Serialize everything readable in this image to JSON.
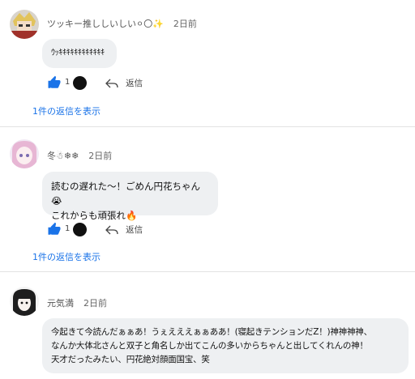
{
  "comments": [
    {
      "author": "ツッキー推ししいしい⚪︎〇✨",
      "time": "2日前",
      "text_lines": [
        "ｳｯｷｷｷｷｷｷｷｷｷｷｷｷ"
      ],
      "like_count": "1",
      "reply_label": "返信",
      "show_replies": "1件の返信を表示"
    },
    {
      "author": "冬☃❄❄",
      "time": "2日前",
      "text_lines": [
        "読むの遅れた〜！ごめん円花ちゃん😭",
        "これからも頑張れ🔥"
      ],
      "like_count": "1",
      "reply_label": "返信",
      "show_replies": "1件の返信を表示"
    },
    {
      "author": "元気満",
      "time": "2日前",
      "text_lines": [
        "今起きて今読んだぁぁあ！うぇえええぁぁああ！(寝起きテンションだZ！)神神神神、",
        "なんか大体北さんと双子と角名しか出てこんの多いからちゃんと出してくれんの神！",
        "天才だったみたい、円花絶対顔面国宝、笑"
      ]
    }
  ],
  "colors": {
    "link": "#1a73e8",
    "like": "#1a73e8",
    "bubble": "#eef0f2"
  }
}
